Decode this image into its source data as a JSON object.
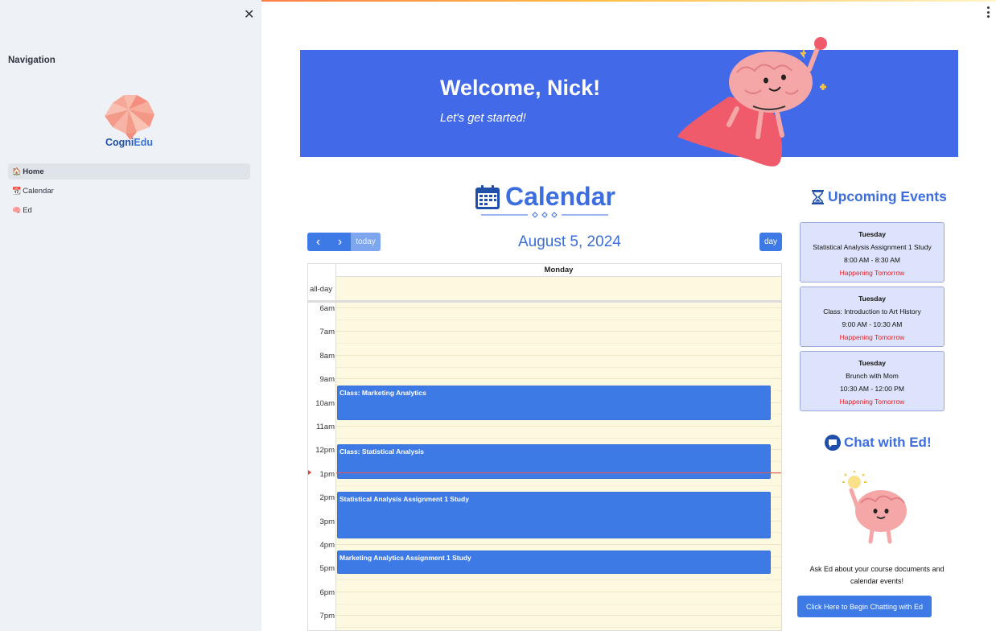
{
  "sidebar": {
    "heading": "Navigation",
    "logo_text_a": "Cogni",
    "logo_text_b": "Edu",
    "items": [
      {
        "icon": "🏠",
        "label": "Home"
      },
      {
        "icon": "📆",
        "label": "Calendar"
      },
      {
        "icon": "🧠",
        "label": "Ed"
      }
    ]
  },
  "banner": {
    "welcome": "Welcome, Nick!",
    "subtitle": "Let's get started!"
  },
  "calendar": {
    "heading": "Calendar",
    "toolbar": {
      "prev": "‹",
      "next": "›",
      "today": "today",
      "day": "day"
    },
    "date_title": "August 5, 2024",
    "day_header": "Monday",
    "allday_label": "all-day",
    "hours": [
      "6am",
      "7am",
      "8am",
      "9am",
      "10am",
      "11am",
      "12pm",
      "1pm",
      "2pm",
      "3pm",
      "4pm",
      "5pm",
      "6pm",
      "7pm"
    ],
    "events": [
      {
        "title": "Class: Marketing Analytics"
      },
      {
        "title": "Class: Statistical Analysis"
      },
      {
        "title": "Statistical Analysis Assignment 1 Study"
      },
      {
        "title": "Marketing Analytics Assignment 1 Study"
      }
    ]
  },
  "upcoming": {
    "heading": "Upcoming Events",
    "cards": [
      {
        "day": "Tuesday",
        "name": "Statistical Analysis Assignment 1 Study",
        "time": "8:00 AM - 8:30 AM",
        "status": "Happening Tomorrow"
      },
      {
        "day": "Tuesday",
        "name": "Class: Introduction to Art History",
        "time": "9:00 AM - 10:30 AM",
        "status": "Happening Tomorrow"
      },
      {
        "day": "Tuesday",
        "name": "Brunch with Mom",
        "time": "10:30 AM - 12:00 PM",
        "status": "Happening Tomorrow"
      }
    ]
  },
  "chat": {
    "heading": "Chat with Ed!",
    "description": "Ask Ed about your course documents and calendar events!",
    "button": "Click Here to Begin Chatting with Ed"
  },
  "colors": {
    "accent": "#3d7ae5",
    "banner": "#4169e8",
    "heading_blue": "#3d6ee0",
    "status_red": "#e8212a"
  }
}
